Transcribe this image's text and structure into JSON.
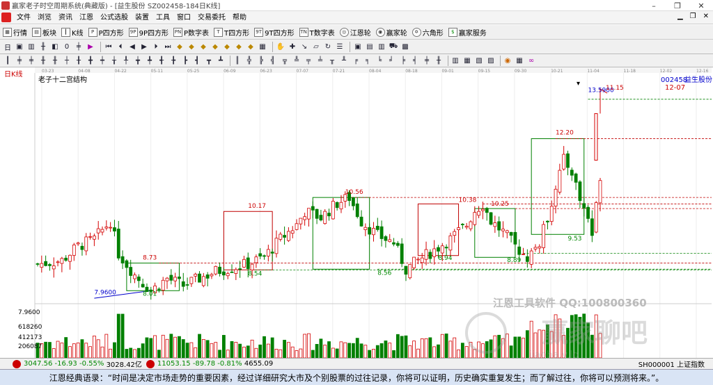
{
  "window": {
    "title": "赢家老子时空周期系统(典藏版) - [益生股份 SZ002458-184日K线]",
    "controls": [
      "–",
      "❐",
      "✕"
    ]
  },
  "menu": {
    "items": [
      "文件",
      "浏览",
      "资讯",
      "江恩",
      "公式选股",
      "装置",
      "工具",
      "窗口",
      "交易委托",
      "帮助"
    ],
    "right": [
      "▁",
      "❐",
      "✕"
    ]
  },
  "toolbar1": {
    "items": [
      {
        "icon": "grid-icon",
        "label": "行情"
      },
      {
        "icon": "blocks-icon",
        "label": "板块"
      },
      {
        "icon": "kline-icon",
        "label": "K线"
      },
      {
        "icon": "p-square-icon",
        "label": "P四方形"
      },
      {
        "icon": "9p-square-icon",
        "label": "9P四方形"
      },
      {
        "icon": "pn-icon",
        "label": "P数字表"
      },
      {
        "icon": "t-square-icon",
        "label": "T四方形"
      },
      {
        "icon": "9t-square-icon",
        "label": "9T四方形"
      },
      {
        "icon": "tn-icon",
        "label": "T数字表"
      },
      {
        "icon": "gann-wheel-icon",
        "label": "江恩轮"
      },
      {
        "icon": "winner-wheel-icon",
        "label": "赢家轮"
      },
      {
        "icon": "hexagon-icon",
        "label": "六角形"
      },
      {
        "icon": "dollar-icon",
        "label": "赢家服务"
      }
    ]
  },
  "chart": {
    "period_label": "日K线",
    "indicator_name": "老子十二宫结构",
    "stock_code": "002458",
    "stock_name": "益生股份",
    "date_ticks": [
      "03-23",
      "04-08",
      "04-22",
      "05-11",
      "05-25",
      "06-09",
      "06-23",
      "07-07",
      "07-21",
      "08-04",
      "08-18",
      "09-01",
      "09-15",
      "09-30",
      "10-21",
      "11-04",
      "11-18",
      "12-02",
      "12-16"
    ],
    "current_date_label": "12-07",
    "price_labels": [
      "7.9600",
      "8.01",
      "8.73",
      "8.54",
      "10.17",
      "10.56",
      "8.56",
      "8.94",
      "10.38",
      "10.25",
      "8.89",
      "9.53",
      "12.20",
      "13.5900"
    ],
    "volume_axis": [
      "618260",
      "412173",
      "206087"
    ],
    "price_axis_label": "7.9600",
    "price_axis_top": "11.15",
    "watermark_text": "江恩工具软件 QQ:100800360",
    "watermark_logo": "赢家聊吧",
    "watermark_url": "iiaoba.v.lo"
  },
  "status": {
    "sh_index": "3047.56",
    "sh_change": "-16.93",
    "sh_pct": "-0.55%",
    "sh_amount": "3028.42亿",
    "sz_index": "11053.15",
    "sz_change": "-89.78",
    "sz_pct": "-0.81%",
    "sz_amount": "4655.09",
    "right_label": "SH000001 上证指数"
  },
  "quote": {
    "text": "江恩经典语录：“时间是决定市场走势的重要因素，经过详细研究大市及个别股票的过往记录，你将可以证明，历史确实重复发生；而了解过往，你将可以预测将来。”。"
  },
  "colors": {
    "up": "#d40000",
    "down": "#008000",
    "box_red": "#c00000",
    "box_green": "#008000",
    "bg": "#ffffff"
  }
}
